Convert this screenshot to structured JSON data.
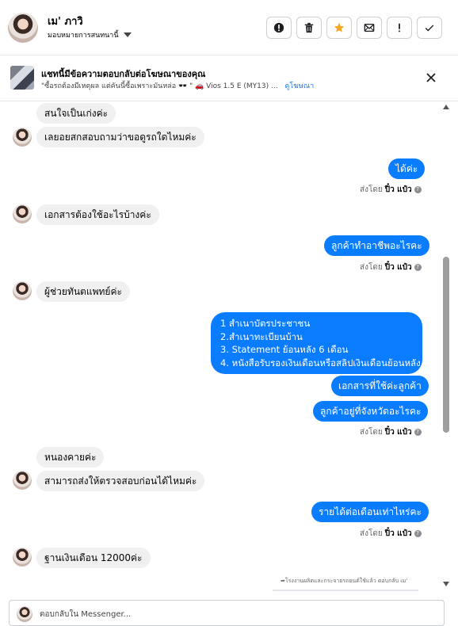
{
  "header": {
    "contact_name": "เม' ภาวิ",
    "assign_label": "มอบหมายการสนทนานี้",
    "action_icons": [
      "alert-circle-icon",
      "trash-icon",
      "star-icon",
      "mail-icon",
      "exclamation-icon",
      "check-icon"
    ]
  },
  "ad_banner": {
    "title": "แชทนี้มีข้อความตอบกลับต่อโฆษณาของคุณ",
    "subtitle": "\"ซื้อรถต้องมีเหตุผล แต่คันนี้ซื้อเพราะมันหล่อ 🕶️ \" 🚗 Vios 1.5 E (MY13) ...",
    "link": "ดูโฆษณา"
  },
  "messages": {
    "m1": "สนใจเป็นเก่งค่ะ",
    "m2": "เลยอยสกสอบถามว่าขอดูรถใดไหมค่ะ",
    "m3": "ได้ค่ะ",
    "m4": "เอกสารต้องใช้อะไรบ้างค่ะ",
    "m5": "ลูกค้าทำอาชีพอะไรคะ",
    "m6": "ผู้ช่วยทันตแพทย์ค่ะ",
    "m7_lines": [
      "1 สำเนาบัตรประชาชน",
      "2.สำเนาทะเบียนบ้าน",
      " 3. Statement ย้อนหลัง 6 เดือน",
      "4. หนังสือรับรองเงินเดือนหรือสลิปเงินเดือนย้อนหลัง"
    ],
    "m8": "เอกสารที่ใช้ค่ะลูกค้า",
    "m9": "ลูกค้าอยู่ที่จังหวัดอะไรคะ",
    "m10": "หนองคายค่ะ",
    "m11": "สามารถส่งให้ตรวจสอบก่อนได้ไหมค่ะ",
    "m12": "รายได้ต่อเดือนเท่าไหร่คะ",
    "m13": "ฐานเงินเดือน 12000ค่ะ"
  },
  "sent_by": {
    "prefix": "ส่งโดย",
    "name": "ปิ๋ว แป๋ว",
    "info": "?"
  },
  "footnote": "โรงงานผลิตและกระจายรถยนต์ใช้แล้ว ตอบกลับ เม'",
  "reply": {
    "placeholder": "ตอบกลับใน Messenger..."
  },
  "colors": {
    "outgoing_bubble": "#0a7cff",
    "incoming_bubble": "#f0f0f0",
    "link": "#1a73e8"
  }
}
